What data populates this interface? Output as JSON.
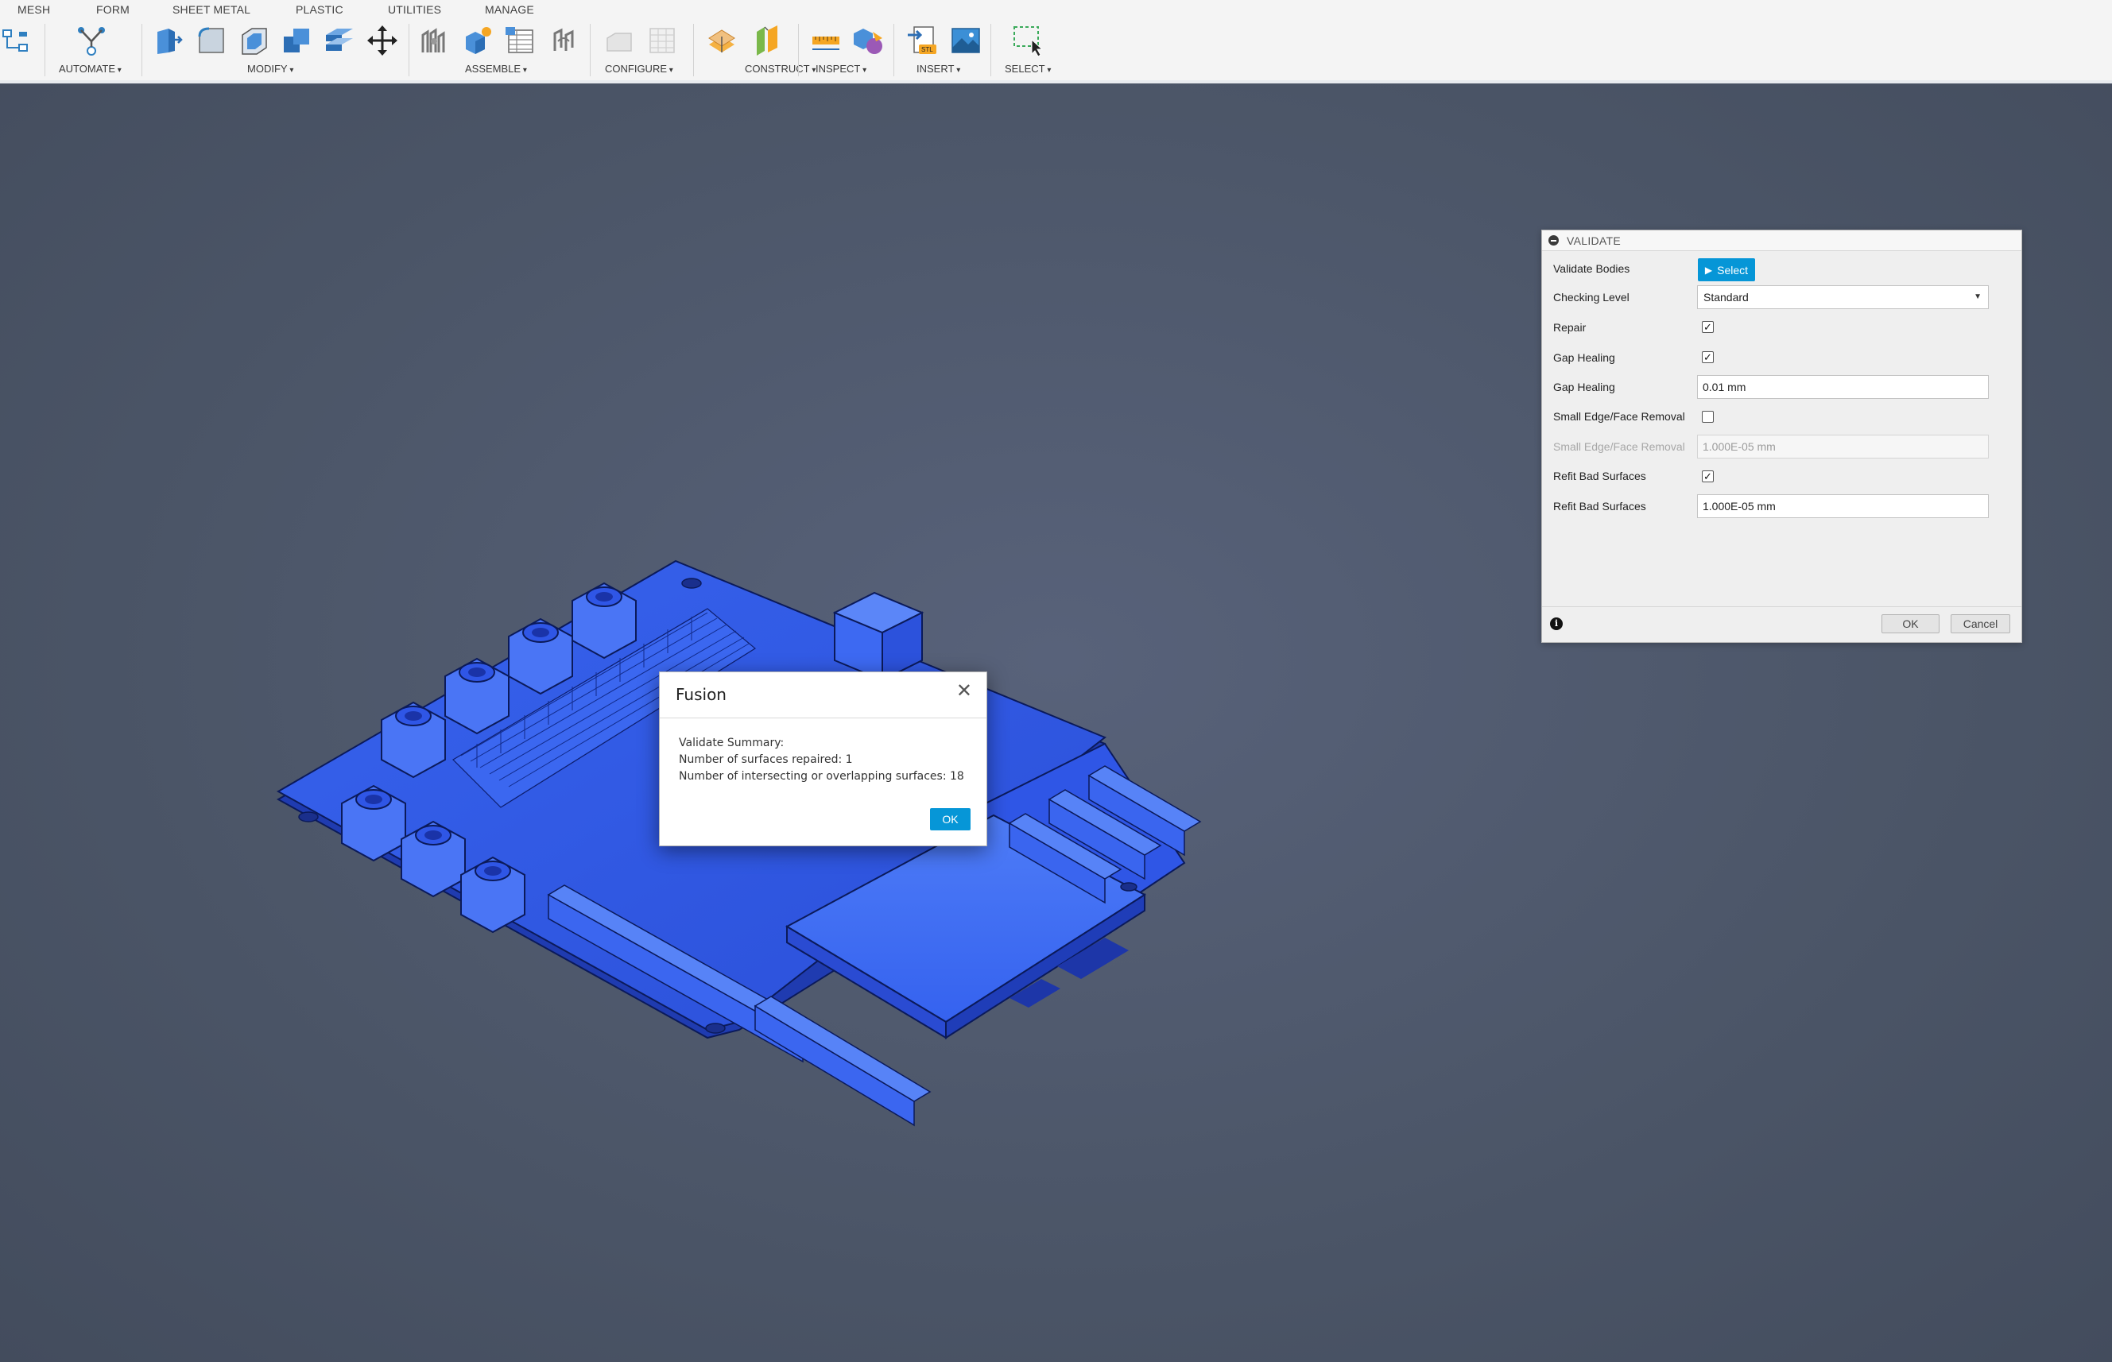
{
  "toolbar": {
    "tabs": [
      "MESH",
      "FORM",
      "SHEET METAL",
      "PLASTIC",
      "UTILITIES",
      "MANAGE"
    ],
    "groups": [
      "AUTOMATE",
      "MODIFY",
      "ASSEMBLE",
      "CONFIGURE",
      "CONSTRUCT",
      "INSPECT",
      "INSERT",
      "SELECT"
    ]
  },
  "validate_panel": {
    "title": "VALIDATE",
    "rows": {
      "validate_bodies": "Validate Bodies",
      "select_button": "Select",
      "checking_level": "Checking Level",
      "checking_level_value": "Standard",
      "repair": "Repair",
      "repair_checked": true,
      "gap_healing": "Gap Healing",
      "gap_healing_checked": true,
      "gap_healing_value_label": "Gap Healing",
      "gap_healing_value": "0.01 mm",
      "small_edge": "Small Edge/Face Removal",
      "small_edge_checked": false,
      "small_edge_value_label": "Small Edge/Face Removal",
      "small_edge_value": "1.000E-05 mm",
      "refit": "Refit Bad Surfaces",
      "refit_checked": true,
      "refit_value_label": "Refit Bad Surfaces",
      "refit_value": "1.000E-05 mm"
    },
    "ok": "OK",
    "cancel": "Cancel"
  },
  "dialog": {
    "title": "Fusion",
    "close": "✕",
    "lines": [
      "Validate Summary:",
      "Number of surfaces repaired: 1",
      "Number of intersecting or overlapping surfaces: 18"
    ],
    "ok": "OK"
  },
  "colors": {
    "accent": "#0696d7",
    "viewport": "#4b5567",
    "model": "#2f5cf2"
  }
}
